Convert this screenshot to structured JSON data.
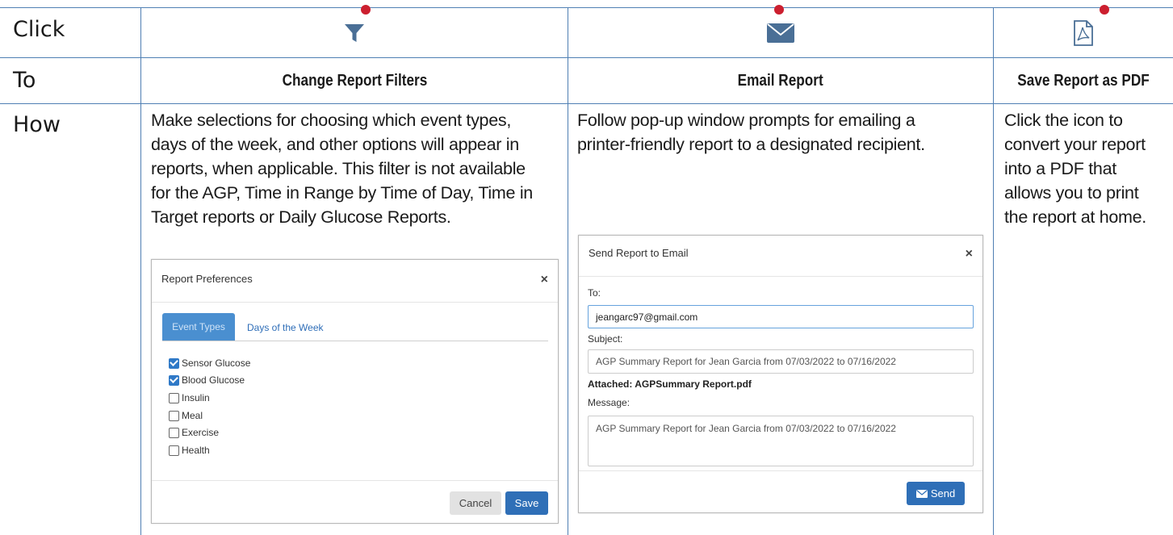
{
  "rows": {
    "click": "Click",
    "to": "To",
    "how": "How"
  },
  "columns": [
    {
      "icon": "filter-icon",
      "heading": "Change Report Filters",
      "description": [
        "Make selections for choosing which event types,",
        "days of the week, and other options will appear in",
        "reports, when applicable. This filter is not available",
        "for the AGP, Time in Range by Time of Day, Time in",
        "Target reports or Daily Glucose Reports."
      ]
    },
    {
      "icon": "envelope-icon",
      "heading": "Email Report",
      "description": [
        "Follow pop-up window prompts for emailing a",
        "printer-friendly report to a designated recipient."
      ]
    },
    {
      "icon": "pdf-icon",
      "heading": "Save Report as PDF",
      "description": [
        "Click the icon to",
        "convert your report",
        "into a PDF that",
        "allows you to print",
        "the report at home."
      ]
    }
  ],
  "prefs_modal": {
    "title": "Report Preferences",
    "close": "×",
    "tabs": [
      "Event Types",
      "Days of the Week"
    ],
    "items": [
      {
        "label": "Sensor Glucose",
        "checked": true
      },
      {
        "label": "Blood Glucose",
        "checked": true
      },
      {
        "label": "Insulin",
        "checked": false
      },
      {
        "label": "Meal",
        "checked": false
      },
      {
        "label": "Exercise",
        "checked": false
      },
      {
        "label": "Health",
        "checked": false
      }
    ],
    "cancel": "Cancel",
    "save": "Save"
  },
  "email_modal": {
    "title": "Send Report to Email",
    "close": "×",
    "to_label": "To:",
    "to_value": "jeangarc97@gmail.com",
    "subject_label": "Subject:",
    "subject_value": "AGP Summary Report for Jean Garcia from 07/03/2022 to 07/16/2022",
    "attached": "Attached: AGPSummary Report.pdf",
    "message_label": "Message:",
    "message_value": "AGP Summary Report for Jean Garcia from 07/03/2022 to 07/16/2022",
    "send": "Send"
  },
  "colors": {
    "rule": "#4f7fb3",
    "marker": "#cc1f2f",
    "icon": "#4a6f96",
    "primary": "#2f6fb7"
  }
}
